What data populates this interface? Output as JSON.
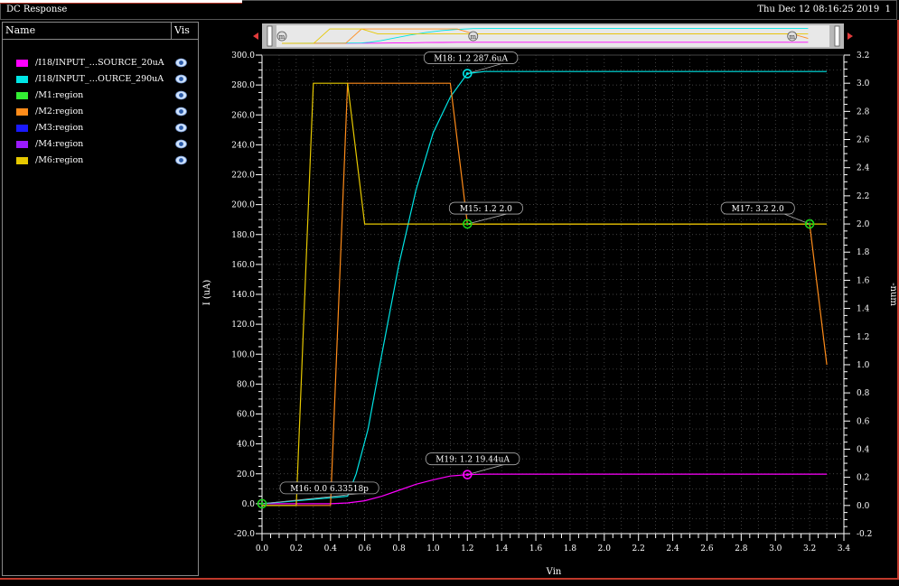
{
  "window": {
    "title": "DC Response",
    "timestamp": "Thu Dec 12 08:16:25 2019",
    "page": "1"
  },
  "legend_panel": {
    "col_name": "Name",
    "col_vis": "Vis"
  },
  "colors": {
    "grid": "#5a5a5a",
    "axis": "#ffffff",
    "marker": "#19d419"
  },
  "chart_data": {
    "type": "line",
    "xlabel": "Vin",
    "ylabel": "I (uA)",
    "y2label": "-num",
    "xlim": [
      0.0,
      3.4
    ],
    "ylim": [
      -20.0,
      300.0
    ],
    "y2lim": [
      -0.2,
      3.2
    ],
    "xticks": [
      "0.0",
      "0.2",
      "0.4",
      "0.6",
      "0.8",
      "1.0",
      "1.2",
      "1.4",
      "1.6",
      "1.8",
      "2.0",
      "2.2",
      "2.4",
      "2.6",
      "2.8",
      "3.0",
      "3.2",
      "3.4"
    ],
    "yticks": [
      "-20.0",
      "0.0",
      "20.0",
      "40.0",
      "60.0",
      "80.0",
      "100.0",
      "120.0",
      "140.0",
      "160.0",
      "180.0",
      "200.0",
      "220.0",
      "240.0",
      "260.0",
      "280.0",
      "300.0"
    ],
    "y2ticks": [
      "-0.2",
      "0.0",
      "0.2",
      "0.4",
      "0.6",
      "0.8",
      "1.0",
      "1.2",
      "1.4",
      "1.6",
      "1.8",
      "2.0",
      "2.2",
      "2.4",
      "2.6",
      "2.8",
      "3.0",
      "3.2"
    ],
    "grid": true,
    "series": [
      {
        "name": "/I18/INPUT_…SOURCE_20uA",
        "color": "#ff00ff",
        "axis": "left",
        "x": [
          0.0,
          0.4,
          0.5,
          0.6,
          0.7,
          0.8,
          0.9,
          1.0,
          1.1,
          1.2,
          1.3,
          3.3
        ],
        "y": [
          0.0,
          0.0,
          0.5,
          2.0,
          5.0,
          9.0,
          13.0,
          16.0,
          18.5,
          19.44,
          19.8,
          19.8
        ]
      },
      {
        "name": "/I18/INPUT_…OURCE_290uA",
        "color": "#00e5e5",
        "axis": "left",
        "x": [
          0.0,
          0.5,
          0.55,
          0.62,
          0.7,
          0.8,
          0.9,
          1.0,
          1.1,
          1.2,
          1.3,
          3.3
        ],
        "y": [
          0.0,
          5.0,
          20.0,
          50.0,
          100.0,
          160.0,
          210.0,
          248.0,
          272.0,
          287.6,
          289.0,
          289.0
        ]
      },
      {
        "name": "/M1:region",
        "color": "#33ee33",
        "axis": "right",
        "x": [],
        "y": []
      },
      {
        "name": "/M2:region",
        "color": "#ff8c1a",
        "axis": "right",
        "x": [
          0.0,
          0.4,
          0.5,
          1.1,
          1.2,
          3.2,
          3.3
        ],
        "y": [
          0.0,
          0.0,
          3.0,
          3.0,
          2.0,
          2.0,
          1.0
        ]
      },
      {
        "name": "/M3:region",
        "color": "#1a1aff",
        "axis": "right",
        "x": [],
        "y": []
      },
      {
        "name": "/M4:region",
        "color": "#9b1aff",
        "axis": "right",
        "x": [],
        "y": []
      },
      {
        "name": "/M6:region",
        "color": "#e6c800",
        "axis": "right",
        "x": [
          0.0,
          0.2,
          0.3,
          0.5,
          0.6,
          3.3
        ],
        "y": [
          0.0,
          0.0,
          3.0,
          3.0,
          2.0,
          2.0
        ]
      }
    ],
    "markers": [
      {
        "label": "M18: 1.2 287.6uA",
        "x": 1.2,
        "y": 287.6,
        "axis": "left",
        "color": "#00e5e5"
      },
      {
        "label": "M15: 1.2 2.0",
        "x": 1.2,
        "y": 2.0,
        "axis": "right",
        "color": "#19d419"
      },
      {
        "label": "M17: 3.2 2.0",
        "x": 3.2,
        "y": 2.0,
        "axis": "right",
        "color": "#19d419"
      },
      {
        "label": "M19: 1.2 19.44uA",
        "x": 1.2,
        "y": 19.44,
        "axis": "left",
        "color": "#ff00ff"
      },
      {
        "label": "M16: 0.0 6.33518p",
        "x": 0.0,
        "y": 0.0,
        "axis": "left",
        "color": "#19d419"
      }
    ]
  }
}
